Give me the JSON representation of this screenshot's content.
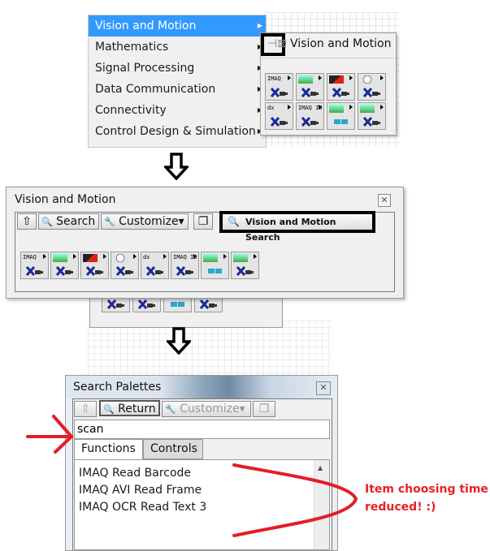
{
  "menu": {
    "items": [
      {
        "label": "Vision and Motion",
        "selected": true
      },
      {
        "label": "Mathematics"
      },
      {
        "label": "Signal Processing"
      },
      {
        "label": "Data Communication"
      },
      {
        "label": "Connectivity"
      },
      {
        "label": "Control Design & Simulation"
      }
    ],
    "submenu_arrow": "▶"
  },
  "palette_popup": {
    "title": "Vision and Motion",
    "pin_icon": "⊣⊠",
    "tiles": [
      {
        "name": "imaq",
        "label": "IMAQ"
      },
      {
        "name": "image-processing",
        "label": ""
      },
      {
        "name": "machine-vision",
        "label": ""
      },
      {
        "name": "vision-utilities",
        "label": ""
      },
      {
        "name": "imaqdx",
        "label": "dx"
      },
      {
        "name": "imaq-io",
        "label": "IMAQ IO"
      },
      {
        "name": "vision-rio",
        "label": ""
      },
      {
        "name": "vision-express",
        "label": ""
      }
    ]
  },
  "window2": {
    "title": "Vision and Motion",
    "close_icon": "✕",
    "toolbar": {
      "up_icon": "⇧",
      "search_label": "Search",
      "search_icon": "🔍",
      "customize_label": "Customize▾",
      "customize_icon": "🔧",
      "restore_icon": "❐"
    },
    "highlight_search_label": "Vision and Motion Search",
    "highlight_search_icon": "🔍"
  },
  "window3": {
    "title": "Search Palettes",
    "close_icon": "✕",
    "toolbar": {
      "up_icon": "⇧",
      "return_label": "Return",
      "return_icon": "🔍",
      "customize_label": "Customize▾",
      "customize_icon": "🔧",
      "restore_icon": "❐"
    },
    "search_value": "scan",
    "tabs": [
      {
        "label": "Functions",
        "active": true
      },
      {
        "label": "Controls",
        "active": false
      }
    ],
    "results": [
      "IMAQ Read Barcode",
      "IMAQ AVI Read Frame",
      "IMAQ OCR Read Text 3"
    ],
    "scroll_up_icon": "▲"
  },
  "annotation": {
    "line1": "Item choosing time",
    "line2": "reduced! :)",
    "color": "#e8202a"
  }
}
